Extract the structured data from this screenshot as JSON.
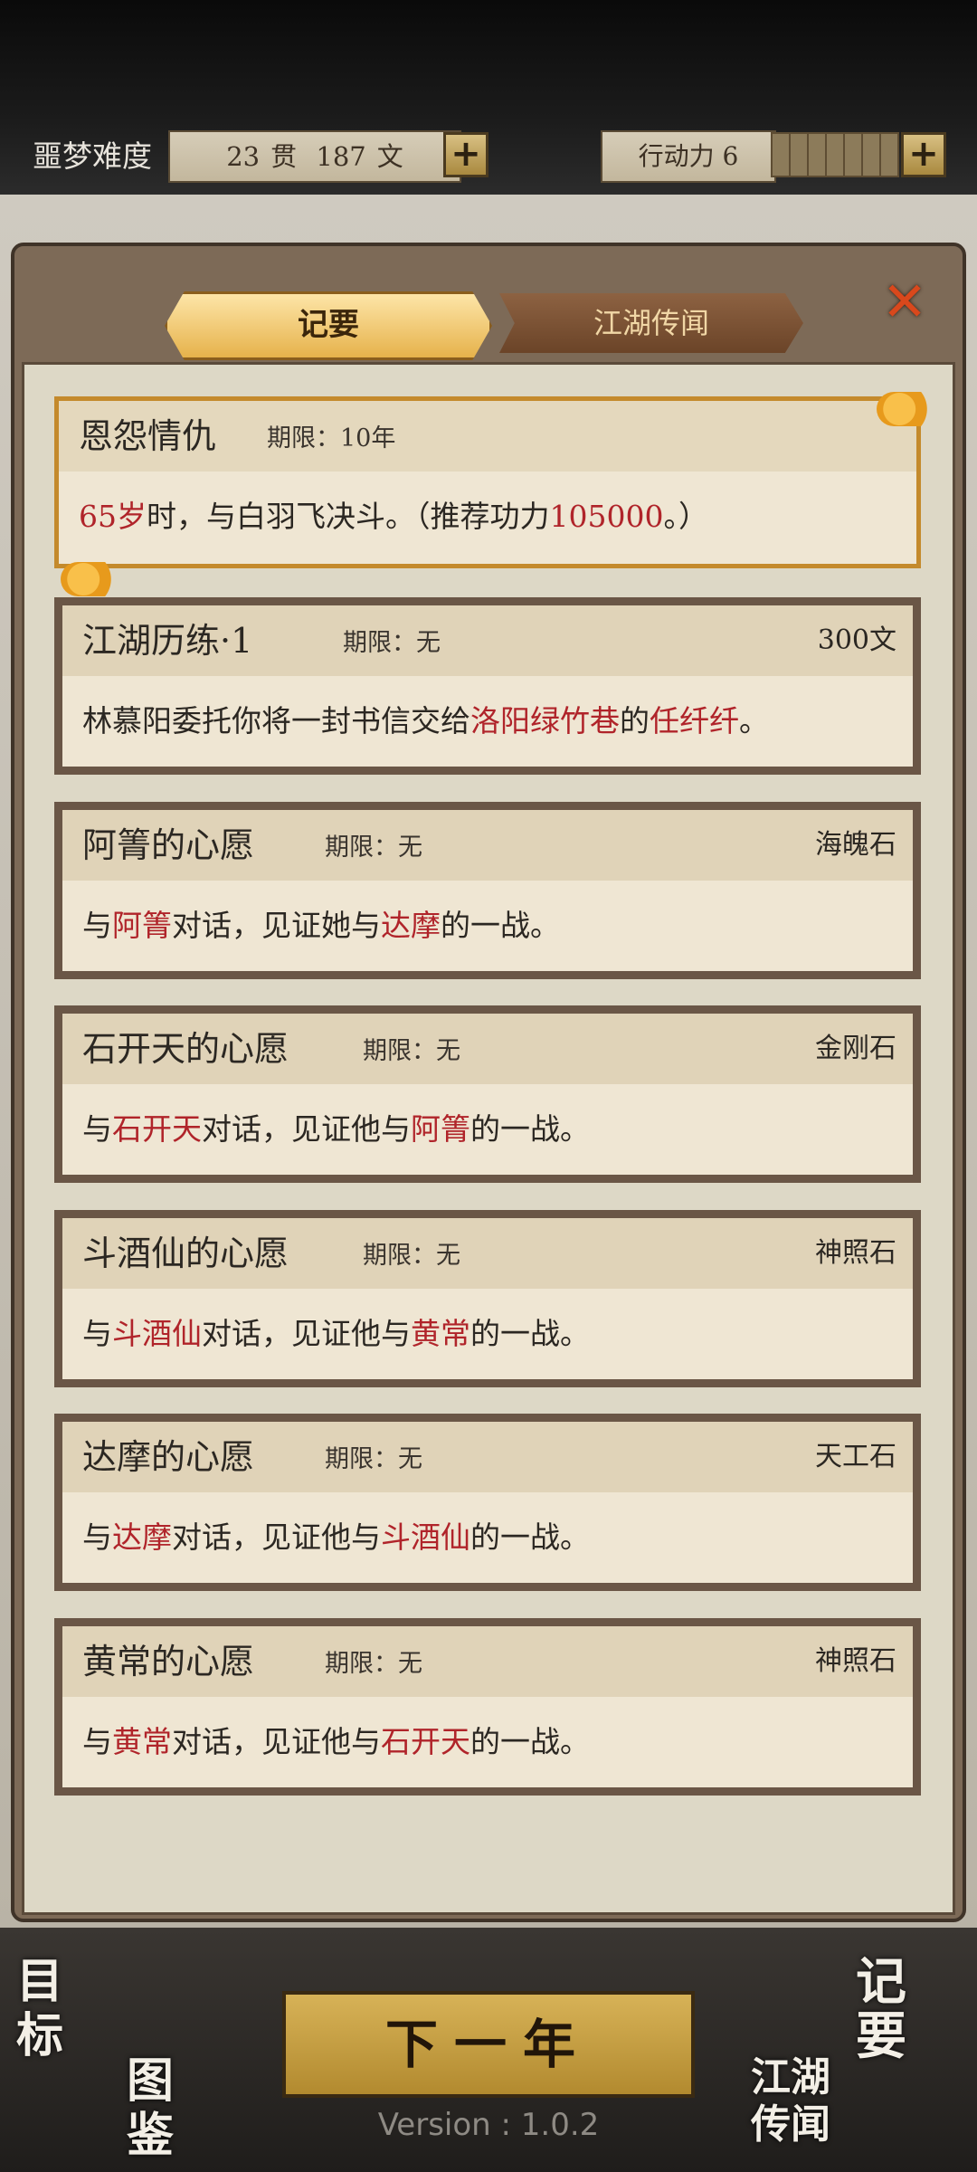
{
  "topbar": {
    "difficulty": "噩梦难度",
    "money_guan": "23",
    "money_guan_unit": "贯",
    "money_wen": "187",
    "money_wen_unit": "文",
    "action_label": "行动力",
    "action_value": "6",
    "plus": "+"
  },
  "tabs": {
    "active": "记要",
    "inactive": "江湖传闻",
    "close": "✕"
  },
  "quests": [
    {
      "title": "恩怨情仇",
      "limit_label": "期限：",
      "limit_value": "10年",
      "reward": "",
      "desc": [
        {
          "t": "65岁",
          "red": true
        },
        {
          "t": "时，与白羽飞决斗。（推荐功力",
          "red": false
        },
        {
          "t": "105000",
          "red": true
        },
        {
          "t": "。）",
          "red": false
        }
      ]
    },
    {
      "title": "江湖历练·1",
      "limit_label": "期限：",
      "limit_value": "无",
      "reward": "300文",
      "desc": [
        {
          "t": "林慕阳委托你将一封书信交给",
          "red": false
        },
        {
          "t": "洛阳绿竹巷",
          "red": true
        },
        {
          "t": "的",
          "red": false
        },
        {
          "t": "任纤纤",
          "red": true
        },
        {
          "t": "。",
          "red": false
        }
      ]
    },
    {
      "title": "阿箐的心愿",
      "limit_label": "期限：",
      "limit_value": "无",
      "reward": "海魄石",
      "desc": [
        {
          "t": "与",
          "red": false
        },
        {
          "t": "阿箐",
          "red": true
        },
        {
          "t": "对话，见证她与",
          "red": false
        },
        {
          "t": "达摩",
          "red": true
        },
        {
          "t": "的一战。",
          "red": false
        }
      ]
    },
    {
      "title": "石开天的心愿",
      "limit_label": "期限：",
      "limit_value": "无",
      "reward": "金刚石",
      "desc": [
        {
          "t": "与",
          "red": false
        },
        {
          "t": "石开天",
          "red": true
        },
        {
          "t": "对话，见证他与",
          "red": false
        },
        {
          "t": "阿箐",
          "red": true
        },
        {
          "t": "的一战。",
          "red": false
        }
      ]
    },
    {
      "title": "斗酒仙的心愿",
      "limit_label": "期限：",
      "limit_value": "无",
      "reward": "神照石",
      "desc": [
        {
          "t": "与",
          "red": false
        },
        {
          "t": "斗酒仙",
          "red": true
        },
        {
          "t": "对话，见证他与",
          "red": false
        },
        {
          "t": "黄常",
          "red": true
        },
        {
          "t": "的一战。",
          "red": false
        }
      ]
    },
    {
      "title": "达摩的心愿",
      "limit_label": "期限：",
      "limit_value": "无",
      "reward": "天工石",
      "desc": [
        {
          "t": "与",
          "red": false
        },
        {
          "t": "达摩",
          "red": true
        },
        {
          "t": "对话，见证他与",
          "red": false
        },
        {
          "t": "斗酒仙",
          "red": true
        },
        {
          "t": "的一战。",
          "red": false
        }
      ]
    },
    {
      "title": "黄常的心愿",
      "limit_label": "期限：",
      "limit_value": "无",
      "reward": "神照石",
      "desc": [
        {
          "t": "与",
          "red": false
        },
        {
          "t": "黄常",
          "red": true
        },
        {
          "t": "对话，见证他与",
          "red": false
        },
        {
          "t": "石开天",
          "red": true
        },
        {
          "t": "的一战。",
          "red": false
        }
      ]
    }
  ],
  "bottom": {
    "next_year": "下一年",
    "goal": "目标",
    "atlas": "图鉴",
    "notes": "记要",
    "rumors": "江湖传闻",
    "version": "Version : 1.0.2"
  },
  "colors": {
    "highlight_red": "#b0242a",
    "gold_accent": "#e6b24b"
  }
}
